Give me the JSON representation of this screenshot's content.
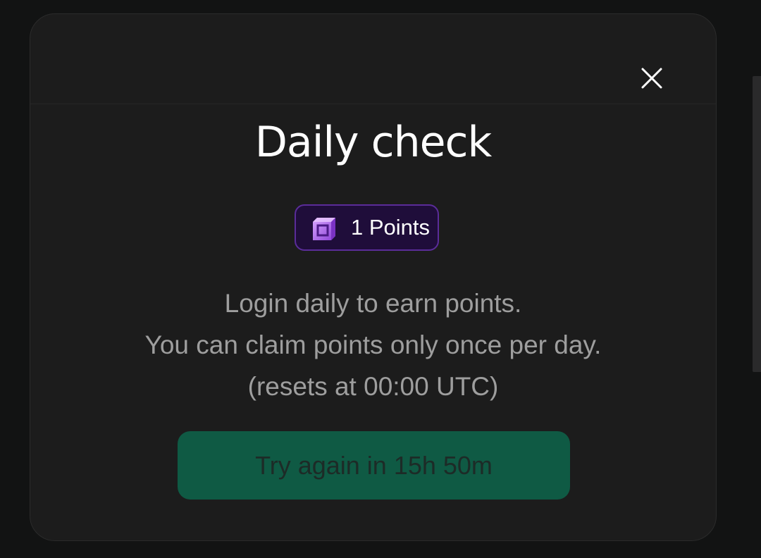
{
  "modal": {
    "title": "Daily check",
    "close_icon": "close-icon",
    "points_badge": {
      "icon": "points-cube-icon",
      "label": "1 Points"
    },
    "description": [
      "Login daily to earn points.",
      "You can claim points only once per day.",
      "(resets at 00:00 UTC)"
    ],
    "retry_button_label": "Try again in 15h 50m"
  },
  "colors": {
    "background": "#121313",
    "modal_background": "#1c1c1c",
    "badge_background": "#1f0d3a",
    "badge_border": "#5a2c99",
    "button_background": "#0f5a44",
    "button_text": "#1d2b27",
    "description_text": "#9e9e9e"
  }
}
